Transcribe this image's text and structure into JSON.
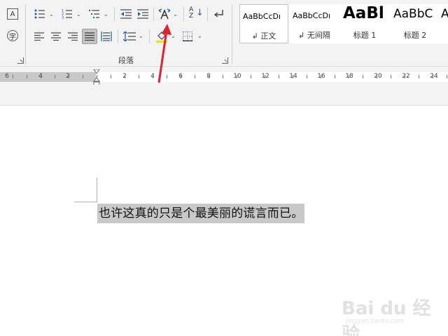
{
  "ribbon": {
    "font_group": {
      "text_box_label": "A",
      "enclose_char_label": "字"
    },
    "paragraph_group": {
      "label": "段落",
      "sort_label": "A",
      "sort_label2": "Z"
    },
    "styles": [
      {
        "sample": "AaBbCcDı",
        "name": "正文",
        "prefix": "↲"
      },
      {
        "sample": "AaBbCcDı",
        "name": "无间隔",
        "prefix": "↲"
      },
      {
        "sample": "AaBl",
        "name": "标题 1",
        "prefix": ""
      },
      {
        "sample": "AaBbC",
        "name": "标题 2",
        "prefix": ""
      },
      {
        "sample": "A",
        "name": "",
        "prefix": ""
      }
    ]
  },
  "ruler": {
    "left_labels": [
      "6",
      "4",
      "2"
    ],
    "right_labels": [
      "2",
      "4",
      "6",
      "8",
      "10",
      "12",
      "14",
      "16",
      "18",
      "20",
      "22",
      "24"
    ]
  },
  "document": {
    "text": "也许这真的只是个最美丽的谎言而已。"
  },
  "watermark": {
    "logo": "Bai du 经验",
    "url": "jingyan.baidu.com"
  },
  "colors": {
    "ribbon_bg": "#f3f3f3",
    "selection": "#c8c8c8",
    "arrow": "#e0202a"
  }
}
